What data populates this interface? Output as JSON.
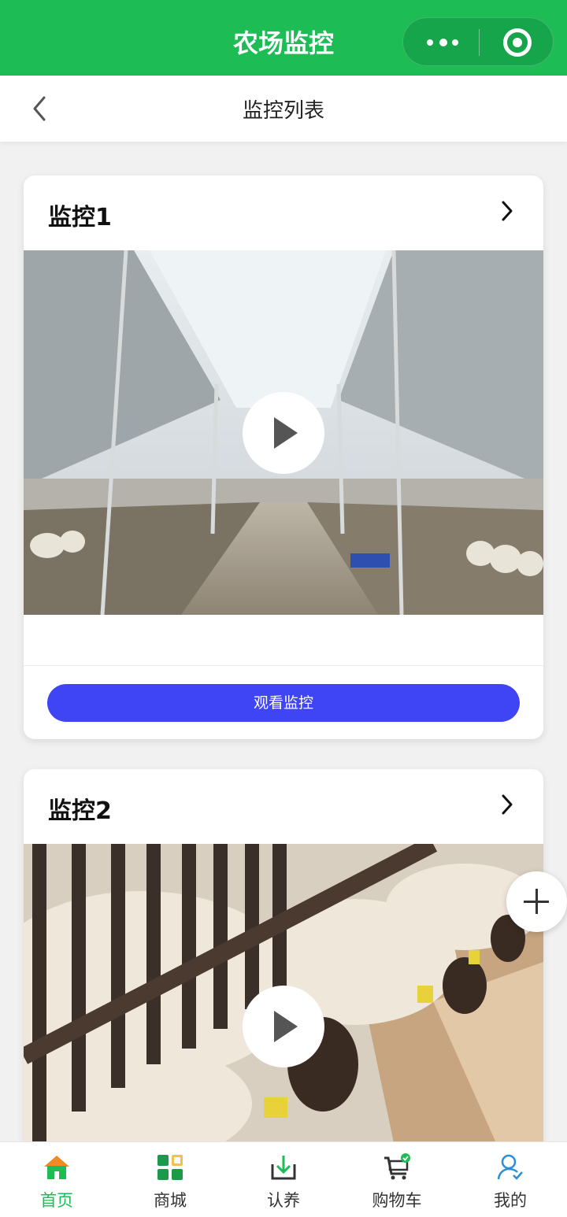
{
  "app": {
    "title": "农场监控"
  },
  "header": {
    "title": "监控列表"
  },
  "monitors": [
    {
      "title": "监控1",
      "button": "观看监控"
    },
    {
      "title": "监控2"
    }
  ],
  "tabs": [
    {
      "label": "首页",
      "icon": "home-icon",
      "active": true
    },
    {
      "label": "商城",
      "icon": "grid-icon"
    },
    {
      "label": "认养",
      "icon": "download-box-icon"
    },
    {
      "label": "购物车",
      "icon": "cart-icon"
    },
    {
      "label": "我的",
      "icon": "user-icon"
    }
  ],
  "colors": {
    "brand_green": "#1dbc55",
    "button_blue": "#3f44f5"
  }
}
